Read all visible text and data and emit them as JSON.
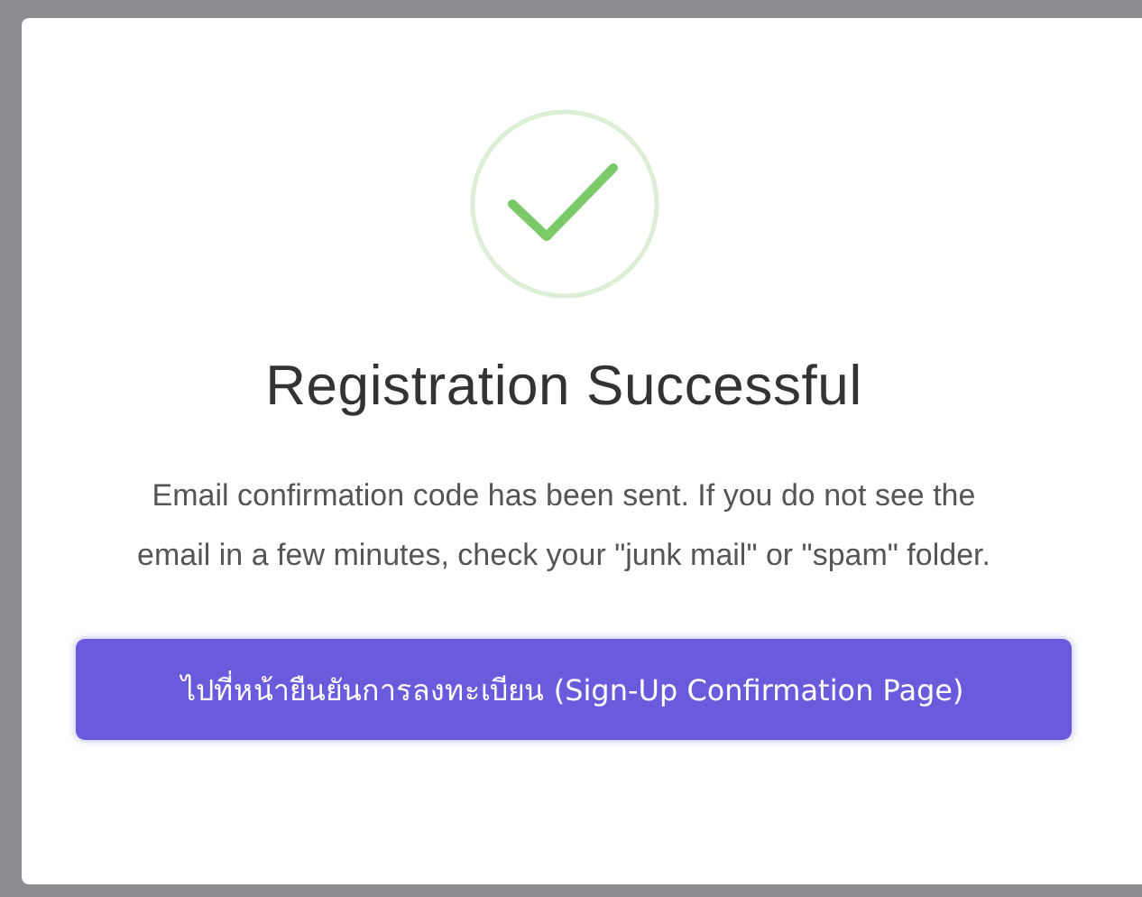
{
  "dialog": {
    "title": "Registration Successful",
    "message": "Email confirmation code has been sent. If you do not see the email in a few minutes, check your \"junk mail\" or \"spam\" folder.",
    "button": "ไปที่หน้ายืนยันการลงทะเบียน (Sign-Up Confirmation Page)"
  }
}
